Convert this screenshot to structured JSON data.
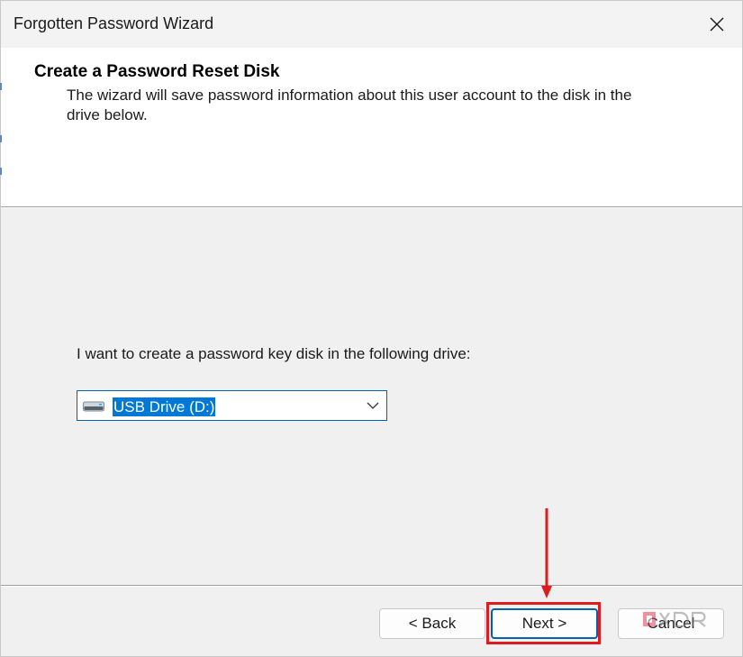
{
  "window": {
    "title": "Forgotten Password Wizard"
  },
  "header": {
    "heading": "Create a Password Reset Disk",
    "description": "The wizard will save password information about this user account to the disk in the drive below."
  },
  "main": {
    "prompt": "I want to create a password key disk in the following drive:",
    "drive_select": {
      "selected": "USB Drive (D:)",
      "icon": "usb-drive-icon"
    }
  },
  "footer": {
    "back_label": "< Back",
    "next_label": "Next >",
    "cancel_label": "Cancel"
  },
  "annotation": {
    "highlight_color": "#e01b1b"
  },
  "colors": {
    "accent": "#0078d7",
    "annotation": "#e01b1b"
  }
}
